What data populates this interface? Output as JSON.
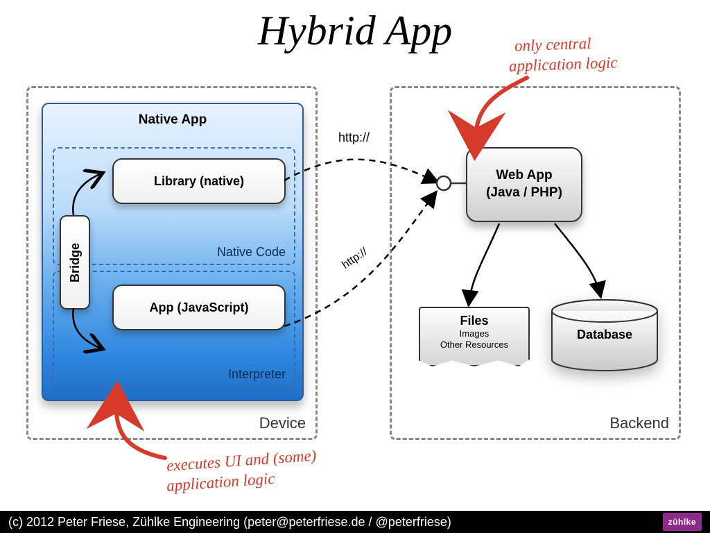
{
  "title": "Hybrid App",
  "device_label": "Device",
  "backend_label": "Backend",
  "native_app_title": "Native App",
  "native_code_label": "Native Code",
  "interpreter_label": "Interpreter",
  "library_label": "Library (native)",
  "bridge_label": "Bridge",
  "app_js_label": "App (JavaScript)",
  "webapp_line1": "Web App",
  "webapp_line2": "(Java / PHP)",
  "files_heading": "Files",
  "files_sub1": "Images",
  "files_sub2": "Other Resources",
  "database_label": "Database",
  "http_label_1": "http://",
  "http_label_2": "http://",
  "annotation_top_line1": "only central",
  "annotation_top_line2": "application logic",
  "annotation_bottom_line1": "executes UI and (some)",
  "annotation_bottom_line2": "application logic",
  "footer_text": "(c) 2012 Peter Friese, Zühlke Engineering (peter@peterfriese.de / @peterfriese)",
  "logo_text": "zühlke"
}
